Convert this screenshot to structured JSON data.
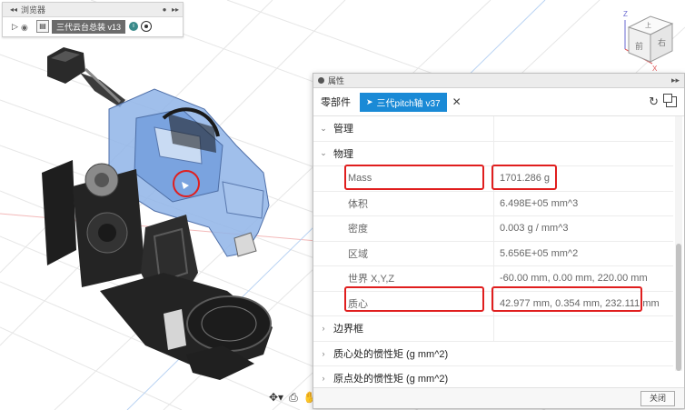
{
  "browser": {
    "title": "浏览器",
    "component_name": "三代云台总装 v13"
  },
  "viewcube": {
    "face_top": "上",
    "face_front": "前",
    "face_right": "右",
    "axis_z": "Z",
    "axis_x": "X"
  },
  "properties": {
    "title": "属性",
    "tab_label": "零部件",
    "selected_component": "三代pitch轴 v37",
    "sections": {
      "management": "管理",
      "physical": "物理",
      "bounding_box": "边界框",
      "inertia_center": "质心处的惯性矩 (g mm^2)",
      "inertia_origin": "原点处的惯性矩 (g mm^2)"
    },
    "physical_rows": [
      {
        "name": "Mass",
        "value": "1701.286 g"
      },
      {
        "name": "体积",
        "value": "6.498E+05 mm^3"
      },
      {
        "name": "密度",
        "value": "0.003 g / mm^3"
      },
      {
        "name": "区域",
        "value": "5.656E+05 mm^2"
      },
      {
        "name": "世界 X,Y,Z",
        "value": "-60.00 mm, 0.00 mm, 220.00 mm"
      },
      {
        "name": "质心",
        "value": "42.977 mm, 0.354 mm, 232.111 mm"
      }
    ],
    "close_label": "关闭"
  },
  "colors": {
    "highlight": "#e01e1e",
    "accent": "#1a8ad6",
    "selection_blue": "#8fb4e8"
  }
}
